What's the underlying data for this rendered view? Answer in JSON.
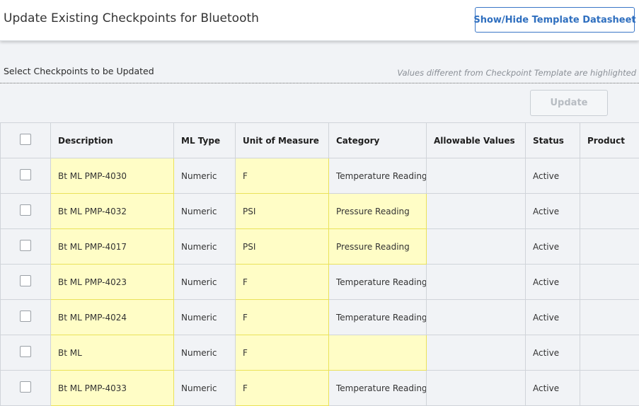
{
  "header": {
    "title": "Update Existing Checkpoints for Bluetooth",
    "template_button": "Show/Hide Template Datasheet"
  },
  "section": {
    "label": "Select Checkpoints to be Updated",
    "hint": "Values different from Checkpoint Template are highlighted"
  },
  "toolbar": {
    "update_label": "Update",
    "update_enabled": false
  },
  "colors": {
    "highlight": "#fffdc6",
    "highlight_border": "#eae25a",
    "accent": "#2f6fbf"
  },
  "table": {
    "columns": [
      "Description",
      "ML Type",
      "Unit of Measure",
      "Category",
      "Allowable Values",
      "Status",
      "Product"
    ],
    "rows": [
      {
        "description": "Bt ML PMP-4030",
        "ml_type": "Numeric",
        "unit": "F",
        "category": "Temperature Reading",
        "allowable": "",
        "status": "Active",
        "product": "",
        "highlight": [
          "description",
          "unit"
        ]
      },
      {
        "description": "Bt ML PMP-4032",
        "ml_type": "Numeric",
        "unit": "PSI",
        "category": "Pressure Reading",
        "allowable": "",
        "status": "Active",
        "product": "",
        "highlight": [
          "description",
          "unit",
          "category"
        ]
      },
      {
        "description": "Bt ML PMP-4017",
        "ml_type": "Numeric",
        "unit": "PSI",
        "category": "Pressure Reading",
        "allowable": "",
        "status": "Active",
        "product": "",
        "highlight": [
          "description",
          "unit",
          "category"
        ]
      },
      {
        "description": "Bt ML PMP-4023",
        "ml_type": "Numeric",
        "unit": "F",
        "category": "Temperature Reading",
        "allowable": "",
        "status": "Active",
        "product": "",
        "highlight": [
          "description",
          "unit"
        ]
      },
      {
        "description": "Bt ML PMP-4024",
        "ml_type": "Numeric",
        "unit": "F",
        "category": "Temperature Reading",
        "allowable": "",
        "status": "Active",
        "product": "",
        "highlight": [
          "description",
          "unit"
        ]
      },
      {
        "description": "Bt ML",
        "ml_type": "Numeric",
        "unit": "F",
        "category": "",
        "allowable": "",
        "status": "Active",
        "product": "",
        "highlight": [
          "description",
          "unit",
          "category"
        ]
      },
      {
        "description": "Bt ML PMP-4033",
        "ml_type": "Numeric",
        "unit": "F",
        "category": "Temperature Reading",
        "allowable": "",
        "status": "Active",
        "product": "",
        "highlight": [
          "description",
          "unit"
        ]
      }
    ]
  }
}
